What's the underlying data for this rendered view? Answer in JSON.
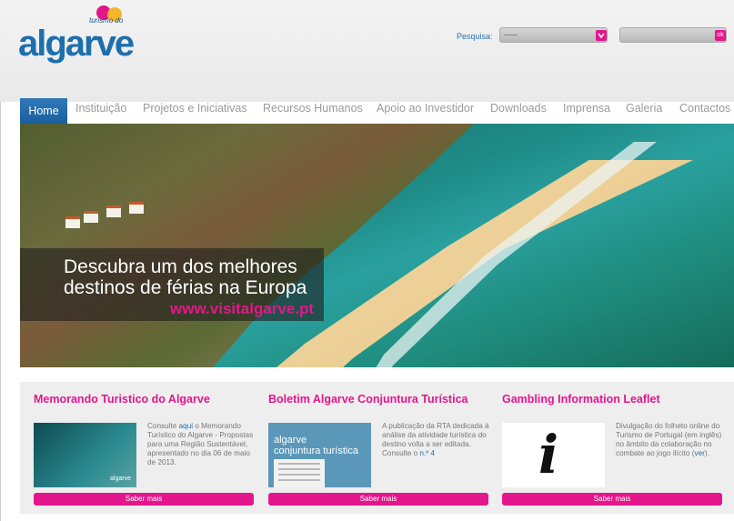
{
  "header": {
    "logo_text": "algarve",
    "logo_sub": "turismo do",
    "search_label": "Pesquisa:",
    "select_value": "-----",
    "ok_label": "ok",
    "search_button_icon": "chevron-icon"
  },
  "nav": {
    "items": [
      {
        "label": "Home"
      },
      {
        "label": "Instituição"
      },
      {
        "label": "Projetos e Iniciativas"
      },
      {
        "label": "Recursos Humanos"
      },
      {
        "label": "Apoio ao Investidor"
      },
      {
        "label": "Downloads"
      },
      {
        "label": "Imprensa"
      },
      {
        "label": "Galeria"
      },
      {
        "label": "Contactos"
      }
    ]
  },
  "hero": {
    "line1": "Descubra um dos melhores",
    "line2": "destinos de férias na Europa",
    "url": "www.visitalgarve.pt"
  },
  "cards": [
    {
      "title": "Memorando Turistico do Algarve",
      "text_before": "Consulte ",
      "link": "aqui",
      "text_after": " o Memorando Turístico do Algarve - Propostas para uma Região Sustentável, apresentado no dia 06 de maio de 2013.",
      "thumb_mark": "algarve",
      "button": "Saber mais"
    },
    {
      "title": "Boletim Algarve Conjuntura Turística",
      "text_before": "A publicação da RTA dedicada à análise da atividade turística do destino volta a ser editada. Consulte o ",
      "link": "n.º 4",
      "text_after": "",
      "thumb_line1": "algarve",
      "thumb_line2": "conjuntura turística",
      "button": "Saber mais"
    },
    {
      "title": "Gambling Information Leaflet",
      "text_before": "Divulgação do folheto online do Turismo de Portugal (em inglês) no âmbito da colaboração no combate ao jogo ilícito (",
      "link": "ver",
      "text_after": ").",
      "thumb_glyph": "i",
      "button": "Saber mais"
    }
  ],
  "colors": {
    "brand_blue": "#1d6fae",
    "accent_pink": "#e4168b"
  }
}
